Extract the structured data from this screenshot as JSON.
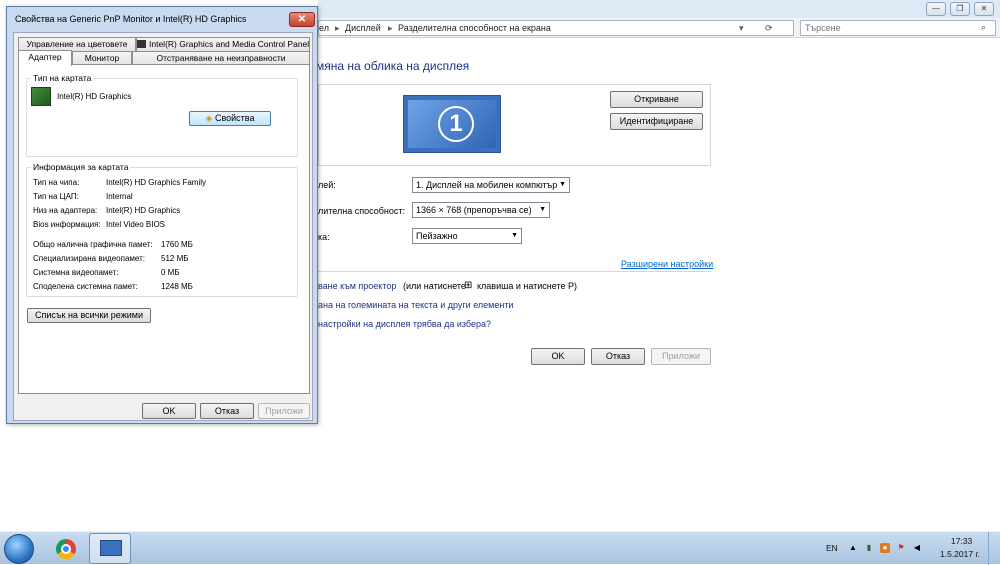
{
  "background_window": {
    "breadcrumbs": [
      "ел",
      "Дисплей",
      "Разделителна способност на екрана"
    ],
    "search_placeholder": "Търсене",
    "heading": "мяна на облика на дисплея",
    "monitor_number": "1",
    "detect_label": "Откриване",
    "identify_label": "Идентифициране",
    "display_label": "лей:",
    "display_value": "1. Дисплей на мобилен компютър",
    "resolution_label": "лителна способност:",
    "resolution_value": "1366 × 768 (препоръчва се)",
    "orientation_label": "ка:",
    "orientation_value": "Пейзажно",
    "advanced_link": "Разширени настройки",
    "projector_link": "ване към проектор",
    "projector_hint_1": "(или натиснете",
    "projector_hint_2": "клавиша и натиснете P)",
    "text_size_link": "ана на големината на текста и други елементи",
    "which_settings_link": "настройки на дисплея трябва да избера?",
    "ok_label": "OK",
    "cancel_label": "Отказ",
    "apply_label": "Приложи"
  },
  "dialog": {
    "title": "Свойства на Generic PnP Monitor и Intel(R) HD Graphics",
    "close_glyph": "✕",
    "tabs_row1": [
      "Управление на цветовете",
      "Intel(R) Graphics and Media Control Panel"
    ],
    "tabs_row2": [
      "Адаптер",
      "Монитор",
      "Отстраняване на неизправности"
    ],
    "adapter_type_group": "Тип на картата",
    "adapter_name": "Intel(R) HD Graphics",
    "properties_button": "Свойства",
    "info_group": "Информация за картата",
    "info_rows": [
      {
        "label": "Тип на чипа:",
        "value": "Intel(R) HD Graphics Family"
      },
      {
        "label": "Тип на ЦАП:",
        "value": "Internal"
      },
      {
        "label": "Низ на адаптера:",
        "value": "Intel(R) HD Graphics"
      },
      {
        "label": "Bios информация:",
        "value": "Intel Video BIOS"
      }
    ],
    "memory_rows": [
      {
        "label": "Общо налична графична памет:",
        "value": "1760 МБ"
      },
      {
        "label": "Специализирана видеопамет:",
        "value": "512 МБ"
      },
      {
        "label": "Системна видеопамет:",
        "value": "0 МБ"
      },
      {
        "label": "Споделена системна памет:",
        "value": "1248 МБ"
      }
    ],
    "list_modes_button": "Списък на всички режими",
    "ok_label": "OK",
    "cancel_label": "Отказ",
    "apply_label": "Приложи"
  },
  "taskbar": {
    "language": "EN",
    "time": "17:33",
    "date": "1.5.2017 г."
  },
  "icons": [
    "start-orb-icon",
    "chrome-icon",
    "display-settings-icon",
    "adapter-card-icon",
    "shield-icon",
    "windows-key-icon",
    "search-icon"
  ]
}
